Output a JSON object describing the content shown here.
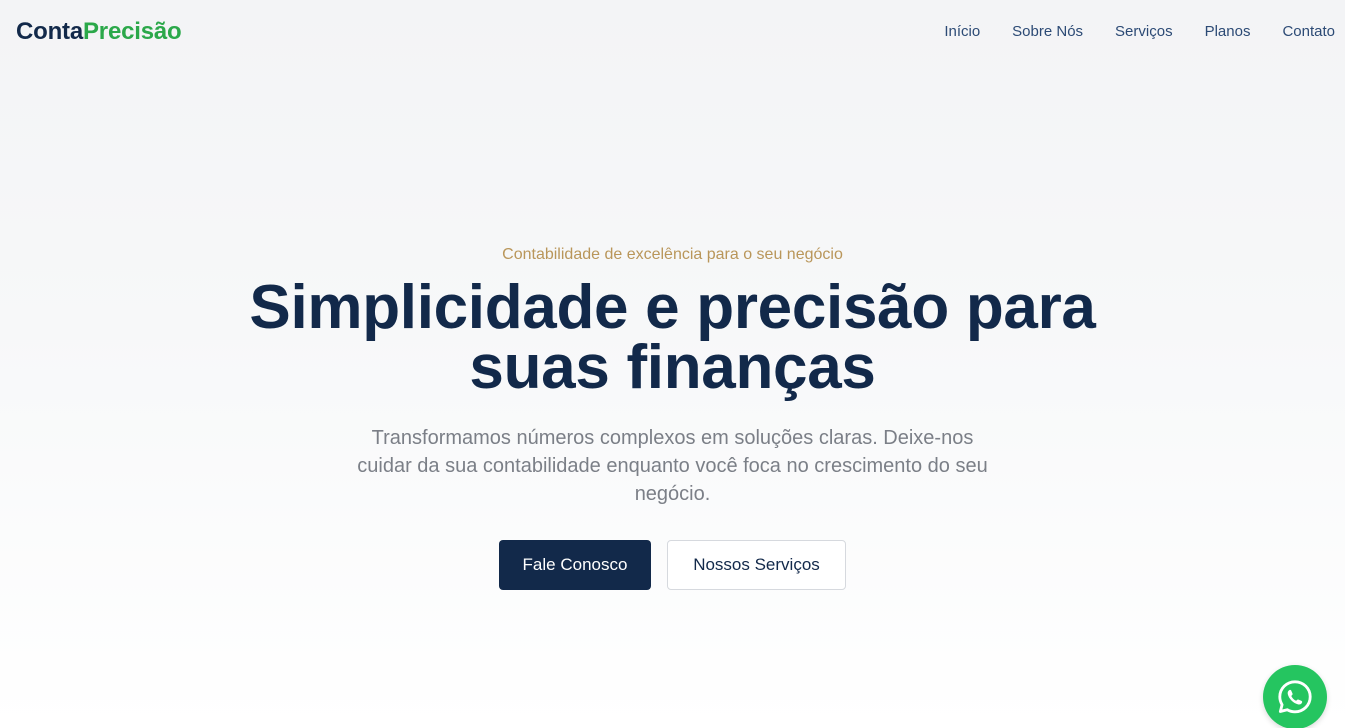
{
  "brand": {
    "part1": "Conta",
    "part2": "Precisão",
    "color_primary": "#12294a",
    "color_accent": "#2ba84a"
  },
  "nav": {
    "items": [
      {
        "label": "Início"
      },
      {
        "label": "Sobre Nós"
      },
      {
        "label": "Serviços"
      },
      {
        "label": "Planos"
      },
      {
        "label": "Contato"
      }
    ]
  },
  "hero": {
    "eyebrow": "Contabilidade de excelência para o seu negócio",
    "title": "Simplicidade e precisão para suas finanças",
    "subtitle": "Transformamos números complexos em soluções claras. Deixe-nos cuidar da sua contabilidade enquanto você foca no crescimento do seu negócio.",
    "cta_primary": "Fale Conosco",
    "cta_secondary": "Nossos Serviços",
    "eyebrow_color": "#b9965a"
  },
  "floating": {
    "icon": "whatsapp-icon",
    "color": "#25c560"
  }
}
